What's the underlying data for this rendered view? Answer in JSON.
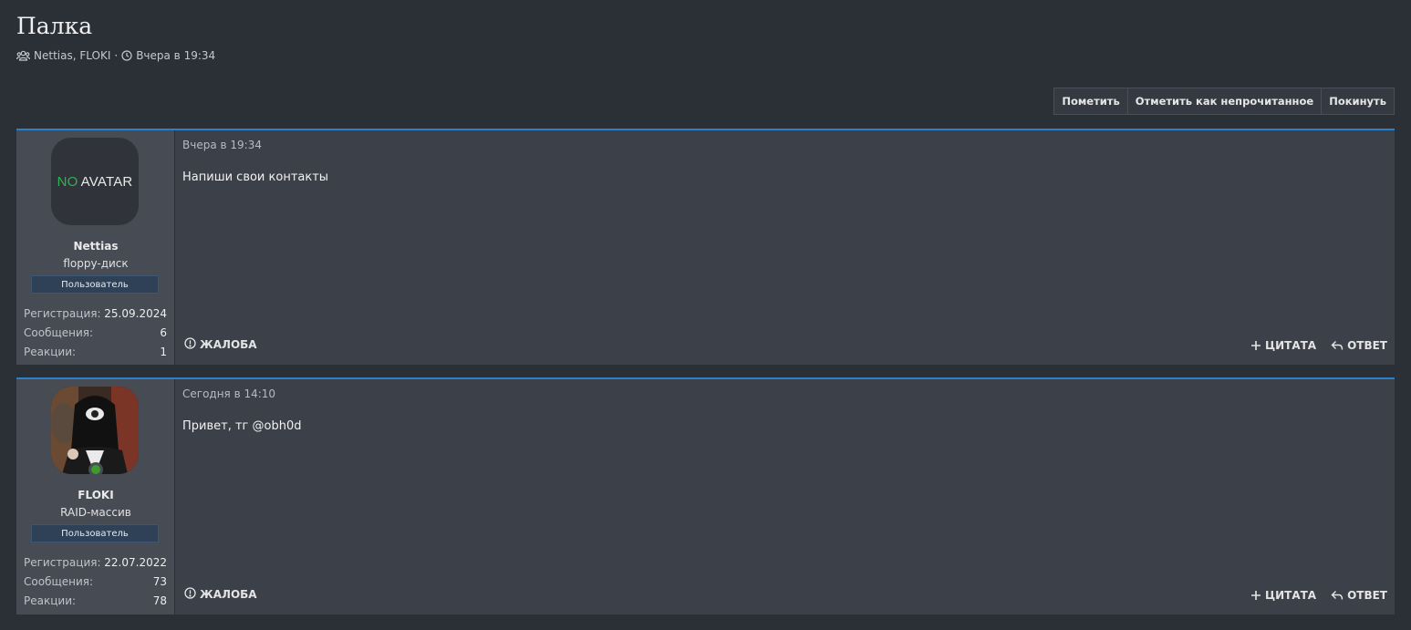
{
  "thread": {
    "title": "Палка",
    "participants": "Nettias, FLOKI",
    "separator": "·",
    "date": "Вчера в 19:34"
  },
  "toolbar": {
    "mark_label": "Пометить",
    "unread_label": "Отметить как непрочитанное",
    "leave_label": "Покинуть"
  },
  "messages": [
    {
      "avatar": {
        "type": "no-avatar",
        "no": "NO",
        "avatar": "AVATAR"
      },
      "username": "Nettias",
      "user_title": "floppy-диск",
      "banner": "Пользователь",
      "stats": [
        {
          "label": "Регистрация:",
          "value": "25.09.2024"
        },
        {
          "label": "Сообщения:",
          "value": "6"
        },
        {
          "label": "Реакции:",
          "value": "1"
        }
      ],
      "date": "Вчера в 19:34",
      "body": "Напиши свои контакты",
      "report_label": "ЖАЛОБА",
      "quote_label": "ЦИТАТА",
      "reply_label": "ОТВЕТ"
    },
    {
      "avatar": {
        "type": "image"
      },
      "username": "FLOKI",
      "user_title": "RAID-массив",
      "banner": "Пользователь",
      "stats": [
        {
          "label": "Регистрация:",
          "value": "22.07.2022"
        },
        {
          "label": "Сообщения:",
          "value": "73"
        },
        {
          "label": "Реакции:",
          "value": "78"
        }
      ],
      "date": "Сегодня в 14:10",
      "body": "Привет, тг @obh0d",
      "report_label": "ЖАЛОБА",
      "quote_label": "ЦИТАТА",
      "reply_label": "ОТВЕТ"
    }
  ],
  "colors": {
    "background": "#2b2f36",
    "accent": "#2f7fc4",
    "online": "#3d9a2f",
    "no_avatar_green": "#2eb34f"
  },
  "icons": [
    "users-icon",
    "clock-icon",
    "report-icon",
    "plus-icon",
    "reply-icon",
    "online-status-icon"
  ]
}
